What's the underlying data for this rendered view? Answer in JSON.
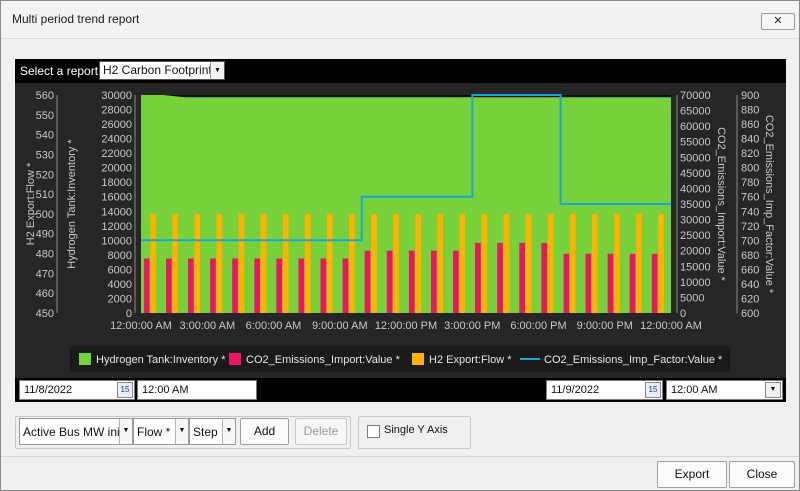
{
  "window": {
    "title": "Multi period trend report",
    "close_glyph": "✕"
  },
  "report": {
    "label": "Select a report:",
    "selected": "H2 Carbon Footprint"
  },
  "chart_data": {
    "type": "bar",
    "categories": [
      "12:00:00 AM",
      "3:00:00 AM",
      "6:00:00 AM",
      "9:00:00 AM",
      "12:00:00 PM",
      "3:00:00 PM",
      "6:00:00 PM",
      "9:00:00 PM",
      "12:00:00 AM"
    ],
    "axes": {
      "left_outer": {
        "label": "H2 Export:Flow *",
        "ticks": [
          "560",
          "550",
          "540",
          "530",
          "520",
          "510",
          "500",
          "490",
          "480",
          "470",
          "460",
          "450"
        ],
        "ylim": [
          450,
          560
        ]
      },
      "left_inner": {
        "label": "Hydrogen Tank:Inventory *",
        "ticks": [
          "30000",
          "28000",
          "26000",
          "24000",
          "22000",
          "20000",
          "18000",
          "16000",
          "14000",
          "12000",
          "10000",
          "8000",
          "6000",
          "4000",
          "2000",
          "0"
        ],
        "ylim": [
          0,
          30000
        ]
      },
      "right_inner": {
        "label": "CO2_Emissions_Import:Value *",
        "ticks": [
          "70000",
          "65000",
          "60000",
          "55000",
          "50000",
          "45000",
          "40000",
          "35000",
          "30000",
          "25000",
          "20000",
          "15000",
          "10000",
          "5000",
          "0"
        ],
        "ylim": [
          0,
          70000
        ]
      },
      "right_outer": {
        "label": "CO2_Emissions_Imp_Factor:Value *",
        "ticks": [
          "900",
          "880",
          "860",
          "840",
          "820",
          "800",
          "780",
          "760",
          "740",
          "720",
          "700",
          "680",
          "660",
          "640",
          "620",
          "600"
        ],
        "ylim": [
          600,
          900
        ]
      }
    },
    "series": [
      {
        "name": "Hydrogen Tank:Inventory *",
        "type": "area",
        "color": "#77d13a",
        "values": [
          30000,
          30000,
          29700,
          29700,
          29700,
          29700,
          29700,
          29700,
          29700,
          29700,
          29700,
          29700,
          29700,
          29700,
          29700,
          29700,
          29700,
          29700,
          29700,
          29700,
          29700,
          29700,
          29700,
          29700,
          29700
        ]
      },
      {
        "name": "CO2_Emissions_Import:Value *",
        "type": "bar",
        "color": "#ec1563",
        "values": [
          17500,
          17500,
          17500,
          17500,
          17500,
          17500,
          17500,
          17500,
          17500,
          17500,
          20000,
          20000,
          20000,
          20000,
          20000,
          22500,
          22500,
          22500,
          22500,
          19000,
          19000,
          19000,
          19000,
          19000
        ]
      },
      {
        "name": "H2 Export:Flow *",
        "type": "bar",
        "color": "#ffb200",
        "values": [
          500,
          500,
          500,
          500,
          500,
          500,
          500,
          500,
          500,
          500,
          500,
          500,
          500,
          500,
          500,
          500,
          500,
          500,
          500,
          500,
          500,
          500,
          500,
          500
        ]
      },
      {
        "name": "CO2_Emissions_Imp_Factor:Value *",
        "type": "step-line",
        "color": "#1aa6d6",
        "values": [
          700,
          700,
          700,
          700,
          700,
          700,
          700,
          700,
          700,
          700,
          760,
          760,
          760,
          760,
          760,
          900,
          900,
          900,
          900,
          750,
          750,
          750,
          750,
          750
        ]
      }
    ]
  },
  "dates": {
    "start_date": "11/8/2022",
    "start_time": "12:00 AM",
    "end_date": "11/9/2022",
    "end_time": "12:00 AM",
    "calendar_glyph": "15",
    "dd_glyph": "▼"
  },
  "controls": {
    "tag": "Active Bus MW ini",
    "attribute": "Flow *",
    "mode": "Step",
    "add": "Add",
    "delete": "Delete",
    "single_axis": "Single Y Axis"
  },
  "footer": {
    "export": "Export",
    "close": "Close"
  }
}
